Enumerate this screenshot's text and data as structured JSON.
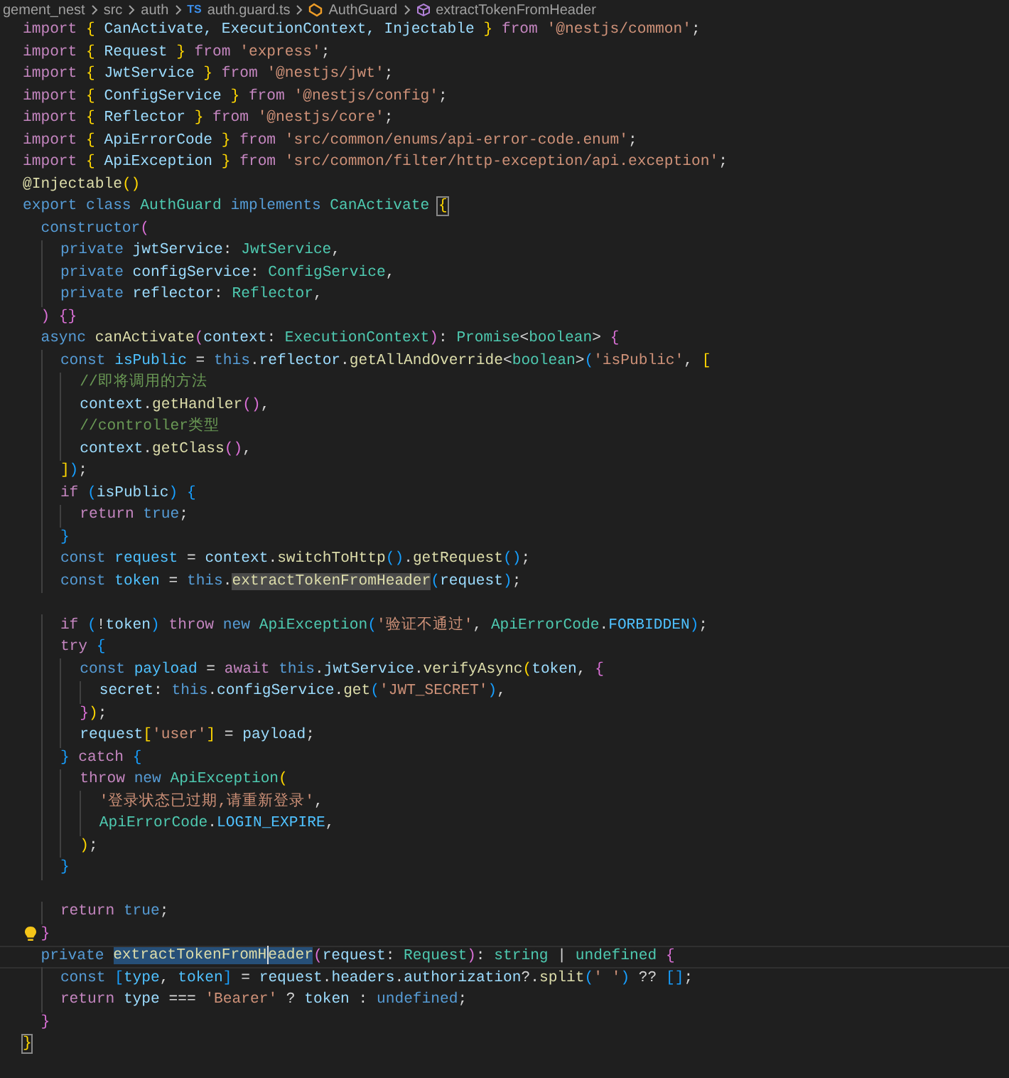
{
  "breadcrumb": [
    {
      "kind": "folder",
      "text": "gement_nest"
    },
    {
      "kind": "folder",
      "text": "src"
    },
    {
      "kind": "folder",
      "text": "auth"
    },
    {
      "kind": "file",
      "icon_text": "TS",
      "text": "auth.guard.ts"
    },
    {
      "kind": "class",
      "text": "AuthGuard"
    },
    {
      "kind": "method",
      "text": "extractTokenFromHeader"
    }
  ],
  "lines": [
    {
      "kind": "code",
      "tokens": [
        {
          "kind": "ctl",
          "text": "import "
        },
        {
          "kind": "b1",
          "text": "{"
        },
        {
          "kind": "var",
          "text": " CanActivate, ExecutionContext, Injectable "
        },
        {
          "kind": "b1",
          "text": "}"
        },
        {
          "kind": "ctl",
          "text": " from "
        },
        {
          "kind": "str",
          "text": "'@nestjs/common'"
        },
        {
          "kind": "plain",
          "text": ";"
        }
      ]
    },
    {
      "kind": "code",
      "tokens": [
        {
          "kind": "ctl",
          "text": "import "
        },
        {
          "kind": "b1",
          "text": "{"
        },
        {
          "kind": "var",
          "text": " Request "
        },
        {
          "kind": "b1",
          "text": "}"
        },
        {
          "kind": "ctl",
          "text": " from "
        },
        {
          "kind": "str",
          "text": "'express'"
        },
        {
          "kind": "plain",
          "text": ";"
        }
      ]
    },
    {
      "kind": "code",
      "tokens": [
        {
          "kind": "ctl",
          "text": "import "
        },
        {
          "kind": "b1",
          "text": "{"
        },
        {
          "kind": "var",
          "text": " JwtService "
        },
        {
          "kind": "b1",
          "text": "}"
        },
        {
          "kind": "ctl",
          "text": " from "
        },
        {
          "kind": "str",
          "text": "'@nestjs/jwt'"
        },
        {
          "kind": "plain",
          "text": ";"
        }
      ]
    },
    {
      "kind": "code",
      "tokens": [
        {
          "kind": "ctl",
          "text": "import "
        },
        {
          "kind": "b1",
          "text": "{"
        },
        {
          "kind": "var",
          "text": " ConfigService "
        },
        {
          "kind": "b1",
          "text": "}"
        },
        {
          "kind": "ctl",
          "text": " from "
        },
        {
          "kind": "str",
          "text": "'@nestjs/config'"
        },
        {
          "kind": "plain",
          "text": ";"
        }
      ]
    },
    {
      "kind": "code",
      "tokens": [
        {
          "kind": "ctl",
          "text": "import "
        },
        {
          "kind": "b1",
          "text": "{"
        },
        {
          "kind": "var",
          "text": " Reflector "
        },
        {
          "kind": "b1",
          "text": "}"
        },
        {
          "kind": "ctl",
          "text": " from "
        },
        {
          "kind": "str",
          "text": "'@nestjs/core'"
        },
        {
          "kind": "plain",
          "text": ";"
        }
      ]
    },
    {
      "kind": "code",
      "tokens": [
        {
          "kind": "ctl",
          "text": "import "
        },
        {
          "kind": "b1",
          "text": "{"
        },
        {
          "kind": "var",
          "text": " ApiErrorCode "
        },
        {
          "kind": "b1",
          "text": "}"
        },
        {
          "kind": "ctl",
          "text": " from "
        },
        {
          "kind": "str",
          "text": "'src/common/enums/api-error-code.enum'"
        },
        {
          "kind": "plain",
          "text": ";"
        }
      ]
    },
    {
      "kind": "code",
      "tokens": [
        {
          "kind": "ctl",
          "text": "import "
        },
        {
          "kind": "b1",
          "text": "{"
        },
        {
          "kind": "var",
          "text": " ApiException "
        },
        {
          "kind": "b1",
          "text": "}"
        },
        {
          "kind": "ctl",
          "text": " from "
        },
        {
          "kind": "str",
          "text": "'src/common/filter/http-exception/api.exception'"
        },
        {
          "kind": "plain",
          "text": ";"
        }
      ]
    },
    {
      "kind": "code",
      "tokens": [
        {
          "kind": "fn",
          "text": "@Injectable"
        },
        {
          "kind": "b1",
          "text": "()"
        }
      ]
    },
    {
      "kind": "code",
      "tokens": [
        {
          "kind": "kw",
          "text": "export class "
        },
        {
          "kind": "type",
          "text": "AuthGuard"
        },
        {
          "kind": "kw",
          "text": " implements "
        },
        {
          "kind": "type",
          "text": "CanActivate "
        },
        {
          "kind": "b1",
          "text": "{",
          "matched": true
        }
      ]
    },
    {
      "kind": "code",
      "tokens": [
        {
          "kind": "kw",
          "text": "  constructor"
        },
        {
          "kind": "b2",
          "text": "("
        }
      ]
    },
    {
      "kind": "code",
      "tokens": [
        {
          "kind": "kw",
          "text": "    private "
        },
        {
          "kind": "var",
          "text": "jwtService"
        },
        {
          "kind": "plain",
          "text": ": "
        },
        {
          "kind": "type",
          "text": "JwtService"
        },
        {
          "kind": "plain",
          "text": ","
        }
      ]
    },
    {
      "kind": "code",
      "tokens": [
        {
          "kind": "kw",
          "text": "    private "
        },
        {
          "kind": "var",
          "text": "configService"
        },
        {
          "kind": "plain",
          "text": ": "
        },
        {
          "kind": "type",
          "text": "ConfigService"
        },
        {
          "kind": "plain",
          "text": ","
        }
      ]
    },
    {
      "kind": "code",
      "tokens": [
        {
          "kind": "kw",
          "text": "    private "
        },
        {
          "kind": "var",
          "text": "reflector"
        },
        {
          "kind": "plain",
          "text": ": "
        },
        {
          "kind": "type",
          "text": "Reflector"
        },
        {
          "kind": "plain",
          "text": ","
        }
      ]
    },
    {
      "kind": "code",
      "tokens": [
        {
          "kind": "b2",
          "text": "  )"
        },
        {
          "kind": "b2",
          "text": " {}"
        }
      ]
    },
    {
      "kind": "code",
      "tokens": [
        {
          "kind": "kw",
          "text": "  async "
        },
        {
          "kind": "fn",
          "text": "canActivate"
        },
        {
          "kind": "b2",
          "text": "("
        },
        {
          "kind": "var",
          "text": "context"
        },
        {
          "kind": "plain",
          "text": ": "
        },
        {
          "kind": "type",
          "text": "ExecutionContext"
        },
        {
          "kind": "b2",
          "text": ")"
        },
        {
          "kind": "plain",
          "text": ": "
        },
        {
          "kind": "type",
          "text": "Promise"
        },
        {
          "kind": "plain",
          "text": "<"
        },
        {
          "kind": "type",
          "text": "boolean"
        },
        {
          "kind": "plain",
          "text": "> "
        },
        {
          "kind": "b2",
          "text": "{"
        }
      ]
    },
    {
      "kind": "code",
      "tokens": [
        {
          "kind": "kw",
          "text": "    const "
        },
        {
          "kind": "const",
          "text": "isPublic"
        },
        {
          "kind": "plain",
          "text": " = "
        },
        {
          "kind": "kw",
          "text": "this"
        },
        {
          "kind": "plain",
          "text": "."
        },
        {
          "kind": "var",
          "text": "reflector"
        },
        {
          "kind": "plain",
          "text": "."
        },
        {
          "kind": "fn",
          "text": "getAllAndOverride"
        },
        {
          "kind": "plain",
          "text": "<"
        },
        {
          "kind": "type",
          "text": "boolean"
        },
        {
          "kind": "plain",
          "text": ">"
        },
        {
          "kind": "b3",
          "text": "("
        },
        {
          "kind": "str",
          "text": "'isPublic'"
        },
        {
          "kind": "plain",
          "text": ", "
        },
        {
          "kind": "b1",
          "text": "["
        }
      ]
    },
    {
      "kind": "code",
      "tokens": [
        {
          "kind": "cmt",
          "text": "      //即将调用的方法"
        }
      ]
    },
    {
      "kind": "code",
      "tokens": [
        {
          "kind": "var",
          "text": "      context"
        },
        {
          "kind": "plain",
          "text": "."
        },
        {
          "kind": "fn",
          "text": "getHandler"
        },
        {
          "kind": "b2",
          "text": "()"
        },
        {
          "kind": "plain",
          "text": ","
        }
      ]
    },
    {
      "kind": "code",
      "tokens": [
        {
          "kind": "cmt",
          "text": "      //controller类型"
        }
      ]
    },
    {
      "kind": "code",
      "tokens": [
        {
          "kind": "var",
          "text": "      context"
        },
        {
          "kind": "plain",
          "text": "."
        },
        {
          "kind": "fn",
          "text": "getClass"
        },
        {
          "kind": "b2",
          "text": "()"
        },
        {
          "kind": "plain",
          "text": ","
        }
      ]
    },
    {
      "kind": "code",
      "tokens": [
        {
          "kind": "b1",
          "text": "    ]"
        },
        {
          "kind": "b3",
          "text": ")"
        },
        {
          "kind": "plain",
          "text": ";"
        }
      ]
    },
    {
      "kind": "code",
      "tokens": [
        {
          "kind": "ctl",
          "text": "    if "
        },
        {
          "kind": "b3",
          "text": "("
        },
        {
          "kind": "var",
          "text": "isPublic"
        },
        {
          "kind": "b3",
          "text": ") {"
        }
      ]
    },
    {
      "kind": "code",
      "tokens": [
        {
          "kind": "ctl",
          "text": "      return "
        },
        {
          "kind": "kw",
          "text": "true"
        },
        {
          "kind": "plain",
          "text": ";"
        }
      ]
    },
    {
      "kind": "code",
      "tokens": [
        {
          "kind": "b3",
          "text": "    }"
        }
      ]
    },
    {
      "kind": "code",
      "tokens": [
        {
          "kind": "kw",
          "text": "    const "
        },
        {
          "kind": "const",
          "text": "request"
        },
        {
          "kind": "plain",
          "text": " = "
        },
        {
          "kind": "var",
          "text": "context"
        },
        {
          "kind": "plain",
          "text": "."
        },
        {
          "kind": "fn",
          "text": "switchToHttp"
        },
        {
          "kind": "b3",
          "text": "()"
        },
        {
          "kind": "plain",
          "text": "."
        },
        {
          "kind": "fn",
          "text": "getRequest"
        },
        {
          "kind": "b3",
          "text": "()"
        },
        {
          "kind": "plain",
          "text": ";"
        }
      ]
    },
    {
      "kind": "code",
      "tokens": [
        {
          "kind": "kw",
          "text": "    const "
        },
        {
          "kind": "const",
          "text": "token"
        },
        {
          "kind": "plain",
          "text": " = "
        },
        {
          "kind": "kw",
          "text": "this"
        },
        {
          "kind": "plain",
          "text": "."
        },
        {
          "kind": "fn",
          "text": "extractTokenFromHeader",
          "highlighted": true
        },
        {
          "kind": "b3",
          "text": "("
        },
        {
          "kind": "var",
          "text": "request"
        },
        {
          "kind": "b3",
          "text": ")"
        },
        {
          "kind": "plain",
          "text": ";"
        }
      ]
    },
    {
      "kind": "blank"
    },
    {
      "kind": "code",
      "tokens": [
        {
          "kind": "ctl",
          "text": "    if "
        },
        {
          "kind": "b3",
          "text": "("
        },
        {
          "kind": "plain",
          "text": "!"
        },
        {
          "kind": "var",
          "text": "token"
        },
        {
          "kind": "b3",
          "text": ")"
        },
        {
          "kind": "ctl",
          "text": " throw "
        },
        {
          "kind": "kw",
          "text": "new "
        },
        {
          "kind": "type",
          "text": "ApiException"
        },
        {
          "kind": "b3",
          "text": "("
        },
        {
          "kind": "str",
          "text": "'验证不通过'"
        },
        {
          "kind": "plain",
          "text": ", "
        },
        {
          "kind": "type",
          "text": "ApiErrorCode"
        },
        {
          "kind": "plain",
          "text": "."
        },
        {
          "kind": "const",
          "text": "FORBIDDEN"
        },
        {
          "kind": "b3",
          "text": ")"
        },
        {
          "kind": "plain",
          "text": ";"
        }
      ]
    },
    {
      "kind": "code",
      "tokens": [
        {
          "kind": "ctl",
          "text": "    try "
        },
        {
          "kind": "b3",
          "text": "{"
        }
      ]
    },
    {
      "kind": "code",
      "tokens": [
        {
          "kind": "kw",
          "text": "      const "
        },
        {
          "kind": "const",
          "text": "payload"
        },
        {
          "kind": "plain",
          "text": " = "
        },
        {
          "kind": "ctl",
          "text": "await "
        },
        {
          "kind": "kw",
          "text": "this"
        },
        {
          "kind": "plain",
          "text": "."
        },
        {
          "kind": "var",
          "text": "jwtService"
        },
        {
          "kind": "plain",
          "text": "."
        },
        {
          "kind": "fn",
          "text": "verifyAsync"
        },
        {
          "kind": "b1",
          "text": "("
        },
        {
          "kind": "var",
          "text": "token"
        },
        {
          "kind": "plain",
          "text": ", "
        },
        {
          "kind": "b2",
          "text": "{"
        }
      ]
    },
    {
      "kind": "code",
      "tokens": [
        {
          "kind": "var",
          "text": "        secret"
        },
        {
          "kind": "plain",
          "text": ": "
        },
        {
          "kind": "kw",
          "text": "this"
        },
        {
          "kind": "plain",
          "text": "."
        },
        {
          "kind": "var",
          "text": "configService"
        },
        {
          "kind": "plain",
          "text": "."
        },
        {
          "kind": "fn",
          "text": "get"
        },
        {
          "kind": "b3",
          "text": "("
        },
        {
          "kind": "str",
          "text": "'JWT_SECRET'"
        },
        {
          "kind": "b3",
          "text": ")"
        },
        {
          "kind": "plain",
          "text": ","
        }
      ]
    },
    {
      "kind": "code",
      "tokens": [
        {
          "kind": "b2",
          "text": "      }"
        },
        {
          "kind": "b1",
          "text": ")"
        },
        {
          "kind": "plain",
          "text": ";"
        }
      ]
    },
    {
      "kind": "code",
      "tokens": [
        {
          "kind": "var",
          "text": "      request"
        },
        {
          "kind": "b1",
          "text": "["
        },
        {
          "kind": "str",
          "text": "'user'"
        },
        {
          "kind": "b1",
          "text": "]"
        },
        {
          "kind": "plain",
          "text": " = "
        },
        {
          "kind": "var",
          "text": "payload"
        },
        {
          "kind": "plain",
          "text": ";"
        }
      ]
    },
    {
      "kind": "code",
      "tokens": [
        {
          "kind": "b3",
          "text": "    }"
        },
        {
          "kind": "ctl",
          "text": " catch "
        },
        {
          "kind": "b3",
          "text": "{"
        }
      ]
    },
    {
      "kind": "code",
      "tokens": [
        {
          "kind": "ctl",
          "text": "      throw "
        },
        {
          "kind": "kw",
          "text": "new "
        },
        {
          "kind": "type",
          "text": "ApiException"
        },
        {
          "kind": "b1",
          "text": "("
        }
      ]
    },
    {
      "kind": "code",
      "tokens": [
        {
          "kind": "str",
          "text": "        '登录状态已过期,请重新登录'"
        },
        {
          "kind": "plain",
          "text": ","
        }
      ]
    },
    {
      "kind": "code",
      "tokens": [
        {
          "kind": "type",
          "text": "        ApiErrorCode"
        },
        {
          "kind": "plain",
          "text": "."
        },
        {
          "kind": "const",
          "text": "LOGIN_EXPIRE"
        },
        {
          "kind": "plain",
          "text": ","
        }
      ]
    },
    {
      "kind": "code",
      "tokens": [
        {
          "kind": "b1",
          "text": "      )"
        },
        {
          "kind": "plain",
          "text": ";"
        }
      ]
    },
    {
      "kind": "code",
      "tokens": [
        {
          "kind": "b3",
          "text": "    }"
        }
      ]
    },
    {
      "kind": "blank"
    },
    {
      "kind": "code",
      "tokens": [
        {
          "kind": "ctl",
          "text": "    return "
        },
        {
          "kind": "kw",
          "text": "true"
        },
        {
          "kind": "plain",
          "text": ";"
        }
      ]
    },
    {
      "kind": "code",
      "lightbulb": true,
      "tokens": [
        {
          "kind": "b2",
          "text": "  }"
        }
      ]
    },
    {
      "kind": "code",
      "current": true,
      "tokens": [
        {
          "kind": "kw",
          "text": "  private "
        },
        {
          "kind": "fn",
          "text": "extractTokenFromH",
          "selected": true,
          "cursor": true
        },
        {
          "kind": "fn",
          "text": "eader",
          "selected": true
        },
        {
          "kind": "b2",
          "text": "("
        },
        {
          "kind": "var",
          "text": "request"
        },
        {
          "kind": "plain",
          "text": ": "
        },
        {
          "kind": "type",
          "text": "Request"
        },
        {
          "kind": "b2",
          "text": ")"
        },
        {
          "kind": "plain",
          "text": ": "
        },
        {
          "kind": "type",
          "text": "string"
        },
        {
          "kind": "plain",
          "text": " | "
        },
        {
          "kind": "type",
          "text": "undefined"
        },
        {
          "kind": "b2",
          "text": " {"
        }
      ]
    },
    {
      "kind": "code",
      "tokens": [
        {
          "kind": "kw",
          "text": "    const "
        },
        {
          "kind": "b3",
          "text": "["
        },
        {
          "kind": "const",
          "text": "type"
        },
        {
          "kind": "plain",
          "text": ", "
        },
        {
          "kind": "const",
          "text": "token"
        },
        {
          "kind": "b3",
          "text": "]"
        },
        {
          "kind": "plain",
          "text": " = "
        },
        {
          "kind": "var",
          "text": "request"
        },
        {
          "kind": "plain",
          "text": "."
        },
        {
          "kind": "var",
          "text": "headers"
        },
        {
          "kind": "plain",
          "text": "."
        },
        {
          "kind": "var",
          "text": "authorization"
        },
        {
          "kind": "plain",
          "text": "?."
        },
        {
          "kind": "fn",
          "text": "split"
        },
        {
          "kind": "b3",
          "text": "("
        },
        {
          "kind": "str",
          "text": "' '"
        },
        {
          "kind": "b3",
          "text": ")"
        },
        {
          "kind": "plain",
          "text": " ?? "
        },
        {
          "kind": "b3",
          "text": "[]"
        },
        {
          "kind": "plain",
          "text": ";"
        }
      ]
    },
    {
      "kind": "code",
      "tokens": [
        {
          "kind": "ctl",
          "text": "    return "
        },
        {
          "kind": "var",
          "text": "type"
        },
        {
          "kind": "plain",
          "text": " === "
        },
        {
          "kind": "str",
          "text": "'Bearer'"
        },
        {
          "kind": "plain",
          "text": " ? "
        },
        {
          "kind": "var",
          "text": "token"
        },
        {
          "kind": "plain",
          "text": " : "
        },
        {
          "kind": "kw",
          "text": "undefined"
        },
        {
          "kind": "plain",
          "text": ";"
        }
      ]
    },
    {
      "kind": "code",
      "tokens": [
        {
          "kind": "b2",
          "text": "  }"
        }
      ]
    },
    {
      "kind": "code",
      "tokens": [
        {
          "kind": "b1",
          "text": "}",
          "matched": true
        }
      ]
    }
  ]
}
